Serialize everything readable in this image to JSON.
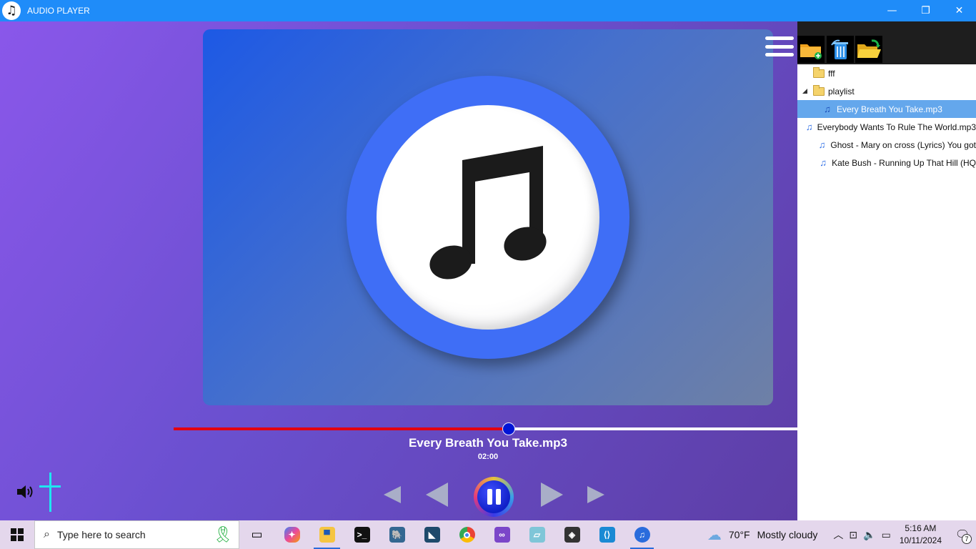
{
  "window": {
    "title": "AUDIO PLAYER",
    "icon": "music-note-icon",
    "minimize_icon": "—",
    "restore_icon": "❐",
    "close_icon": "✕"
  },
  "player": {
    "song_title": "Every Breath You Take.mp3",
    "time": "02:00",
    "progress_fraction": 0.537,
    "accent_color": "#e3000f",
    "knob_color": "#0014d6",
    "volume_icon": "speaker-icon"
  },
  "toolbar": {
    "menu_icon": "hamburger-menu-icon",
    "buttons": [
      "add-folder-icon",
      "delete-icon",
      "open-folder-icon"
    ]
  },
  "playlist": {
    "items": [
      {
        "type": "folder",
        "label": "fff"
      },
      {
        "type": "folder",
        "label": "playlist",
        "expanded": true
      },
      {
        "type": "file",
        "label": "Every Breath You Take.mp3",
        "selected": true
      },
      {
        "type": "file",
        "label": "Everybody Wants To Rule The World.mp3"
      },
      {
        "type": "file",
        "label": "Ghost - Mary on cross (Lyrics) You got"
      },
      {
        "type": "file",
        "label": "Kate Bush - Running Up That Hill (HQ"
      }
    ]
  },
  "taskbar": {
    "search_placeholder": "Type here to search",
    "apps": [
      "task-view-icon",
      "copilot-icon",
      "file-explorer-icon",
      "terminal-icon",
      "postgres-icon",
      "mysql-icon",
      "chrome-icon",
      "visual-studio-icon",
      "app-icon",
      "unity-icon",
      "vscode-icon",
      "music-player-icon"
    ],
    "weather_temp": "70°F",
    "weather_text": "Mostly cloudy",
    "time": "5:16 AM",
    "date": "10/11/2024",
    "notification_count": "7"
  }
}
